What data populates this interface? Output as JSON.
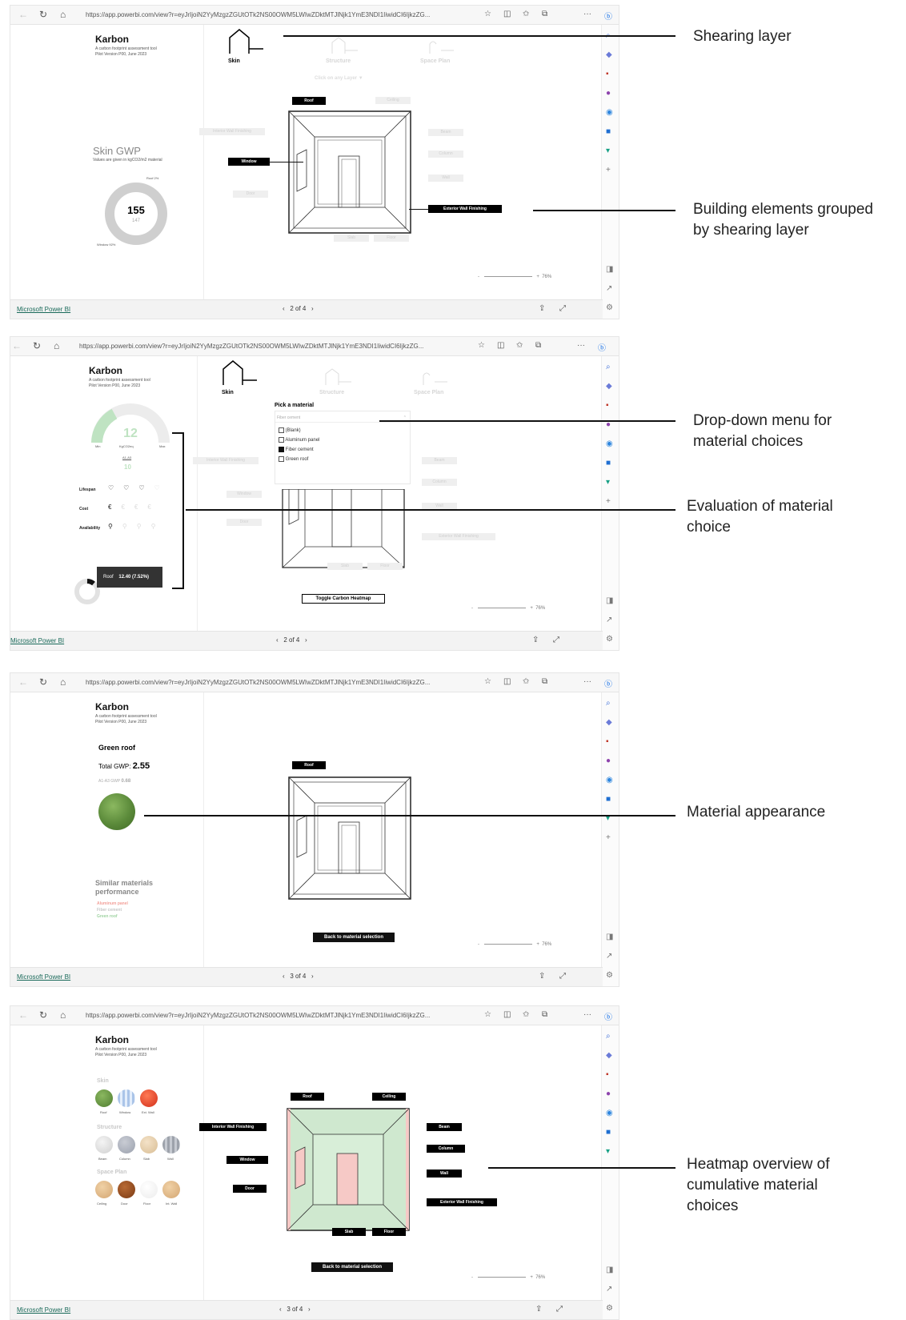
{
  "browser": {
    "url": "https://app.powerbi.com/view?r=eyJrIjoiN2YyMzgzZGUtOTk2NS00OWM5LWIwZDktMTJlNjk1YmE3NDI1IiwidCI6IjkzZG...",
    "brand": "Microsoft Power BI",
    "zoom": "76%"
  },
  "app": {
    "title": "Karbon",
    "subtitle_line1": "A carbon footprint assessment tool",
    "subtitle_line2": "Pilot Version P00, June 2023"
  },
  "layers": {
    "skin": "Skin",
    "structure": "Structure",
    "space_plan": "Space Plan",
    "hint": "Click on any Layer ▼"
  },
  "panel1": {
    "pager": "2 of 4",
    "gwp_title": "Skin GWP",
    "gwp_sub": "Values are given in kgCO2/m2 material",
    "donut_value": "155",
    "donut_sub": "147",
    "roof_pct": "Roof 2%",
    "window_pct": "Window 92%",
    "tags": {
      "roof": "Roof",
      "window": "Window",
      "exterior": "Exterior Wall Finishing"
    },
    "ghosts": [
      "Ceiling",
      "Interior Wall Finishing",
      "Beam",
      "Column",
      "Wall",
      "Door",
      "Slab",
      "Floor"
    ]
  },
  "panel2": {
    "pager": "2 of 4",
    "gauge_value": "12",
    "gauge_min": "Min",
    "gauge_max": "Max",
    "gauge_unit": "KgCO2eq",
    "gauge_stage": "A1-A3",
    "gauge_extra": "10",
    "eval_rows": [
      "Lifespan",
      "Cost",
      "Availability"
    ],
    "pick_title": "Pick a material",
    "search_placeholder": "Fiber cement",
    "options": [
      "(Blank)",
      "Aluminum panel",
      "Fiber cement",
      "Green roof"
    ],
    "tooltip_label": "Roof",
    "tooltip_value": "12.40 (7.52%)",
    "toggle_button": "Toggle Carbon Heatmap",
    "ghosts": [
      "Interior Wall Finishing",
      "Beam",
      "Column",
      "Window",
      "Wall",
      "Door",
      "Exterior Wall Finishing",
      "Slab",
      "Floor"
    ]
  },
  "panel3": {
    "pager": "3 of 4",
    "material_name": "Green roof",
    "total_label": "Total GWP:",
    "total_value": "2.55",
    "stage_label": "A1-A3 GWP",
    "stage_value": "0.68",
    "similar_title_1": "Similar materials",
    "similar_title_2": "performance",
    "similar": [
      "Aluminum panel",
      "Fiber cement",
      "Green roof"
    ],
    "roof_tag": "Roof",
    "back_button": "Back to material selection"
  },
  "panel4": {
    "pager": "3 of 4",
    "skin_title": "Skin",
    "structure_title": "Structure",
    "space_title": "Space Plan",
    "skin_items": [
      "Roof",
      "Window",
      "Ext. Wall"
    ],
    "structure_items": [
      "Beam",
      "Column",
      "Slab",
      "Wall"
    ],
    "space_items": [
      "Ceiling",
      "Door",
      "Floor",
      "Int. Wall"
    ],
    "tags": {
      "roof": "Roof",
      "ceiling": "Ceiling",
      "interior": "Interior Wall Finishing",
      "beam": "Beam",
      "column": "Column",
      "window": "Window",
      "wall": "Wall",
      "door": "Door",
      "exterior": "Exterior Wall Finishing",
      "slab": "Slab",
      "floor": "Floor"
    },
    "back_button": "Back to material selection"
  },
  "annotations": {
    "a1": "Shearing layer",
    "a2_1": "Building elements grouped",
    "a2_2": "by shearing layer",
    "a3_1": "Drop-down menu for",
    "a3_2": "material choices",
    "a4_1": "Evaluation of material",
    "a4_2": "choice",
    "a5": "Material appearance",
    "a6_1": "Heatmap overview of",
    "a6_2": "cumulative material",
    "a6_3": "choices"
  },
  "colors": {
    "brand_link": "#1a6a5a",
    "heatmap_green": "#cfe8cf",
    "heatmap_red": "#f6c9c6",
    "grass": "#5b8a3a",
    "gauge_green": "#bfe3c2"
  }
}
